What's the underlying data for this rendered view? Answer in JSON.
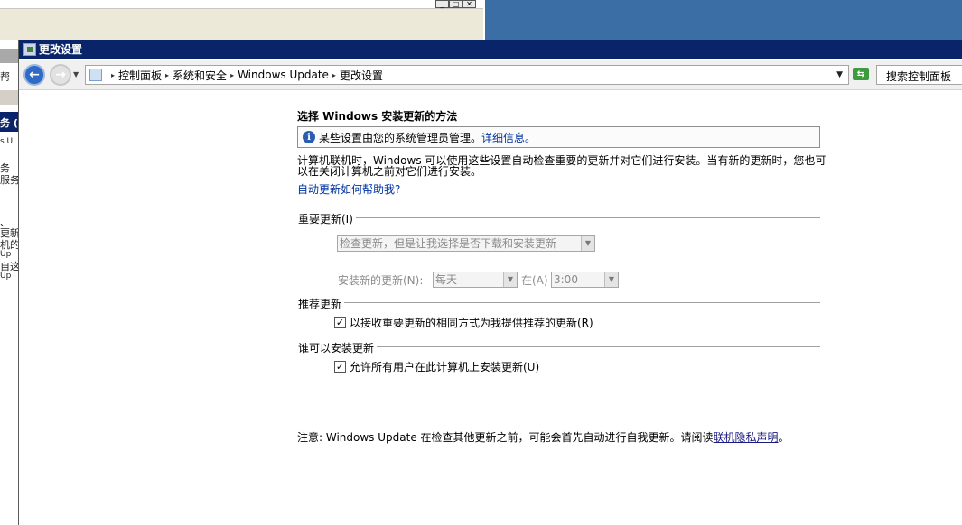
{
  "background": {
    "left_fragments": [
      "帮",
      "务 (",
      "s U",
      "务",
      "服务",
      "、",
      "更新",
      "机的",
      "Up",
      "自这",
      "Up"
    ]
  },
  "window": {
    "title": "更改设置"
  },
  "navbar": {
    "breadcrumbs": [
      "控制面板",
      "系统和安全",
      "Windows Update",
      "更改设置"
    ],
    "search_placeholder": "搜索控制面板"
  },
  "content": {
    "heading": "选择 Windows 安装更新的方法",
    "info_text": "某些设置由您的系统管理员管理。",
    "info_link": "详细信息。",
    "description": "计算机联机时，Windows 可以使用这些设置自动检查重要的更新并对它们进行安装。当有新的更新时，您也可以在关闭计算机之前对它们进行安装。",
    "help_link": "自动更新如何帮助我?",
    "important": {
      "label": "重要更新(I)",
      "mode_value": "检查更新，但是让我选择是否下载和安装更新",
      "install_label": "安装新的更新(N):",
      "day_value": "每天",
      "at_label": "在(A)",
      "time_value": "3:00"
    },
    "recommended": {
      "label": "推荐更新",
      "checkbox_label": "以接收重要更新的相同方式为我提供推荐的更新(R)",
      "checked": true
    },
    "who": {
      "label": "谁可以安装更新",
      "checkbox_label": "允许所有用户在此计算机上安装更新(U)",
      "checked": true
    },
    "note_prefix": "注意: Windows Update 在检查其他更新之前，可能会首先自动进行自我更新。请阅读",
    "note_link": "联机隐私声明",
    "note_suffix": "。"
  },
  "colors": {
    "titlebar": "#0a246a",
    "link": "#0033a0",
    "desktop": "#3a6ea5"
  }
}
